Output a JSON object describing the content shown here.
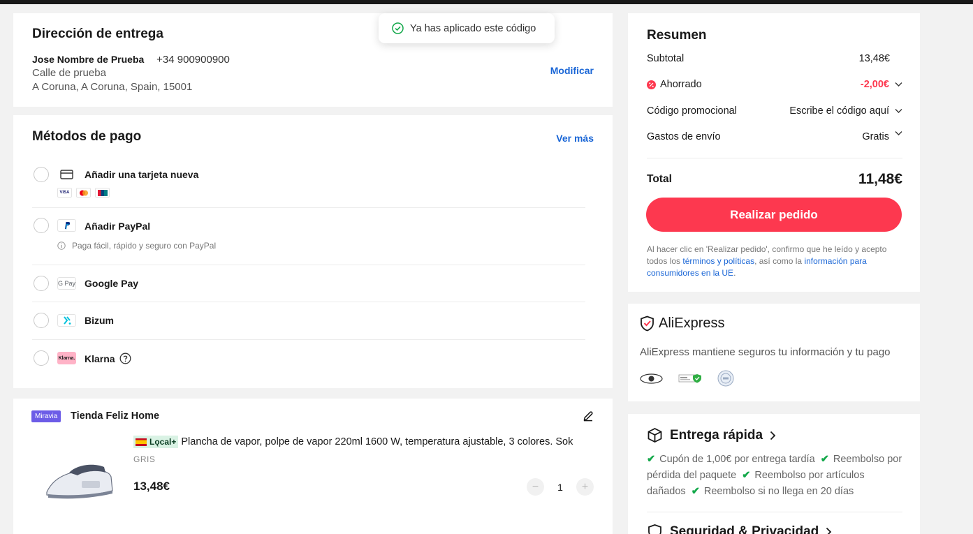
{
  "toast": {
    "message": "Ya has aplicado este código"
  },
  "address": {
    "title": "Dirección de entrega",
    "name": "Jose Nombre de Prueba",
    "phone": "+34 900900900",
    "street": "Calle de prueba",
    "city": "A Coruna, A Coruna, Spain, 15001",
    "modify_label": "Modificar"
  },
  "payment": {
    "title": "Métodos de pago",
    "more_label": "Ver más",
    "methods": [
      {
        "label": "Añadir una tarjeta nueva",
        "icon": "credit-card-icon",
        "cards": [
          "VISA",
          "MC",
          "UP"
        ]
      },
      {
        "label": "Añadir PayPal",
        "icon": "paypal-icon",
        "note": "Paga fácil, rápido y seguro con PayPal"
      },
      {
        "label": "Google Pay",
        "icon": "google-pay-icon",
        "icon_text": "G Pay"
      },
      {
        "label": "Bizum",
        "icon": "bizum-icon"
      },
      {
        "label": "Klarna",
        "icon": "klarna-icon",
        "icon_text": "Klarna."
      }
    ]
  },
  "store": {
    "badge": "Miravia",
    "name": "Tienda Feliz Home",
    "local_badge": "Lǫcal+",
    "product_title": "Plancha de vapor, polpe de vapor 220ml 1600 W, temperatura ajustable, 3 colores. Sok",
    "variant": "GRIS",
    "price": "13,48€",
    "quantity": "1"
  },
  "summary": {
    "title": "Resumen",
    "subtotal_label": "Subtotal",
    "subtotal_value": "13,48€",
    "saved_label": "Ahorrado",
    "saved_value": "-2,00€",
    "promo_label": "Código promocional",
    "promo_value": "Escribe el código aquí",
    "shipping_label": "Gastos de envío",
    "shipping_value": "Gratis",
    "total_label": "Total",
    "total_value": "11,48€",
    "order_button": "Realizar pedido",
    "legal_1": "Al hacer clic en 'Realizar pedido', confirmo que he leído y acepto todos los ",
    "legal_link_1": "términos y políticas",
    "legal_2": ", así como la ",
    "legal_link_2": "información para consumidores en la UE",
    "legal_3": ".",
    "accent_color": "#fd384f"
  },
  "trust": {
    "brand": "AliExpress",
    "secure_text": "AliExpress mantiene seguros tu información y tu pago"
  },
  "delivery": {
    "title": "Entrega rápida",
    "perks": [
      "Cupón de 1,00€ por entrega tardía",
      "Reembolso por pérdida del paquete",
      "Reembolso por artículos dañados",
      "Reembolso si no llega en 20 días"
    ],
    "security_title": "Seguridad & Privacidad"
  }
}
